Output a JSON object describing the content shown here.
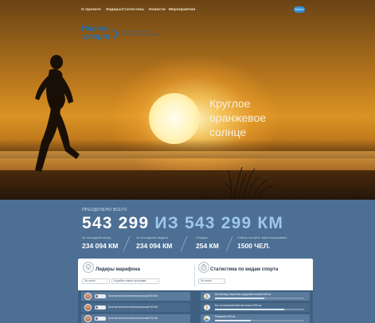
{
  "nav": {
    "links": [
      "О проекте",
      "Лидеры",
      "Статистика",
      "Новости",
      "Мероприятия"
    ],
    "login_label": "Войти"
  },
  "logo": {
    "word1": "Интел",
    "word2": "спорт",
    "tagline": "ЦЕНТР СПОРТИВНОЙ ЭФФЕКТИВНОЙ ПОДГОТОВКИ"
  },
  "hero": {
    "headline_lines": [
      "Круглое",
      "оранжевое",
      "солнце"
    ]
  },
  "stats": {
    "overcome_label": "ПРЕОДОЛЕНО ВСЕГО",
    "total_value": "543 299",
    "total_of": "ИЗ 543 299 КМ",
    "items": [
      {
        "label": "За последний месяц",
        "value": "234 094 КМ"
      },
      {
        "label": "За последнюю неделю",
        "value": "234 094 КМ"
      },
      {
        "label": "Сегодня",
        "value": "254 КМ"
      },
      {
        "label": "Сейчас на сайте зарегистрировано",
        "value": "1500 ЧЕЛ."
      }
    ]
  },
  "leaders": {
    "title": "Лидеры марафона",
    "filter1": "За сезон",
    "filter2": "Корабли самых программ",
    "rows": [
      {
        "text": "Константин Константинопольский  56 КМ"
      },
      {
        "text": "Константин Константинопольский  45 КМ"
      },
      {
        "text": "Константин Константинопольский  34 КМ"
      }
    ]
  },
  "sports": {
    "title": "Статистика по видам спорта",
    "filter": "За сезон",
    "rows": [
      {
        "icon": "🚴",
        "text": "Велосипед спортивно-оздоровительный  345 км",
        "progress": 0.55
      },
      {
        "icon": "🏃",
        "text": "Бег по пересечённой местности  999 км",
        "progress": 0.78
      },
      {
        "icon": "🏊",
        "text": "Плавание  345 км",
        "progress": 0.4
      }
    ]
  }
}
